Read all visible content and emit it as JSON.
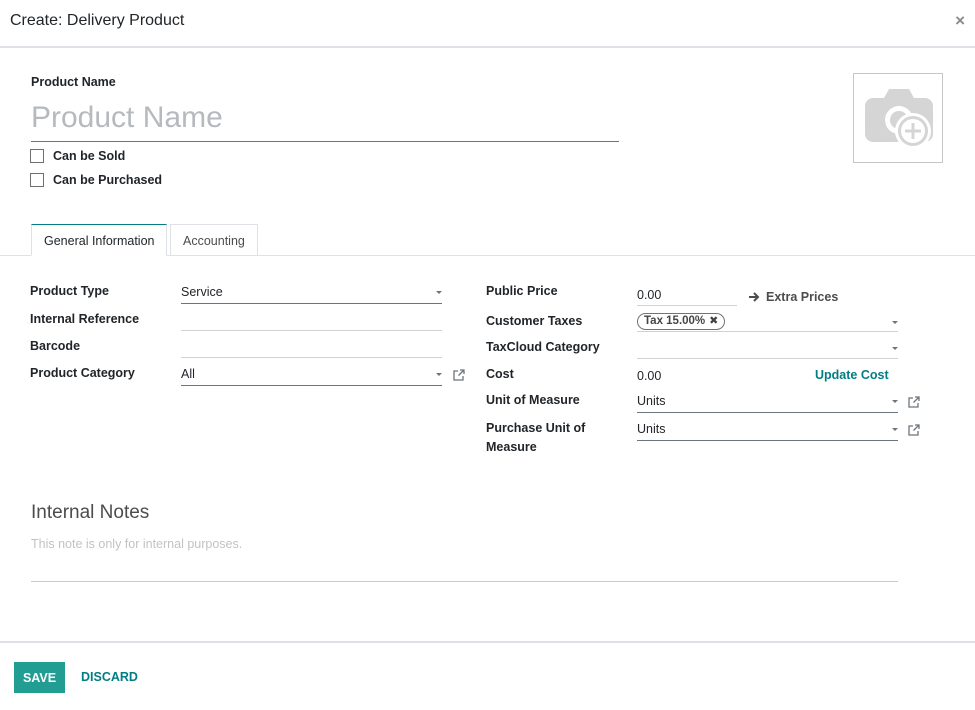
{
  "dialog": {
    "title": "Create: Delivery Product",
    "close": "×"
  },
  "product": {
    "name_label": "Product Name",
    "name_placeholder": "Product Name",
    "can_be_sold": "Can be Sold",
    "can_be_purchased": "Can be Purchased"
  },
  "tabs": [
    {
      "label": "General Information",
      "active": true
    },
    {
      "label": "Accounting",
      "active": false
    }
  ],
  "general": {
    "left": {
      "product_type": {
        "label": "Product Type",
        "value": "Service"
      },
      "internal_reference": {
        "label": "Internal Reference",
        "value": ""
      },
      "barcode": {
        "label": "Barcode",
        "value": ""
      },
      "product_category": {
        "label": "Product Category",
        "value": "All"
      }
    },
    "right": {
      "public_price": {
        "label": "Public Price",
        "value": "0.00"
      },
      "extra_prices": "Extra Prices",
      "customer_taxes": {
        "label": "Customer Taxes",
        "tag": "Tax 15.00%"
      },
      "taxcloud_category": {
        "label": "TaxCloud Category",
        "value": ""
      },
      "cost": {
        "label": "Cost",
        "value": "0.00"
      },
      "update_cost": "Update Cost",
      "unit_of_measure": {
        "label": "Unit of Measure",
        "value": "Units"
      },
      "purchase_uom": {
        "label_line1": "Purchase Unit of",
        "label_line2": "Measure",
        "value": "Units"
      }
    }
  },
  "notes": {
    "title": "Internal Notes",
    "placeholder": "This note is only for internal purposes."
  },
  "footer": {
    "save": "SAVE",
    "discard": "DISCARD"
  },
  "colors": {
    "accent": "#017e84",
    "save_bg": "#229d93"
  }
}
